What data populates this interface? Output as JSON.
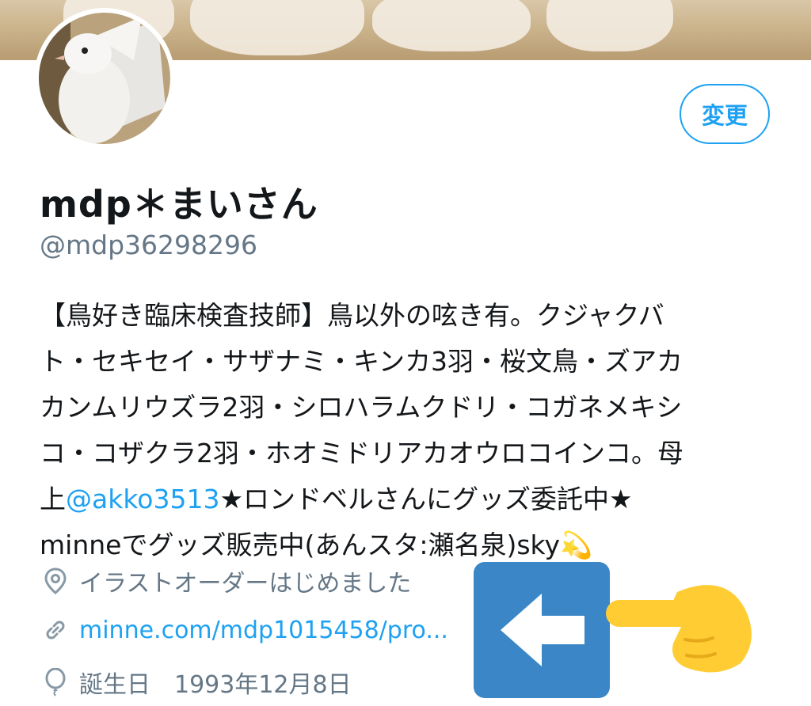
{
  "profile": {
    "edit_button": "変更",
    "display_name": "mdp＊まいさん",
    "handle": "@mdp36298296",
    "bio": {
      "line1": "【鳥好き臨床検査技師】鳥以外の呟き有。クジャクバ",
      "line2": "ト・セキセイ・サザナミ・キンカ3羽・桜文鳥・ズアカ",
      "line3": "カンムリウズラ2羽・シロハラムクドリ・コガネメキシ",
      "line4": "コ・コザクラ2羽・ホオミドリアカオウロコインコ。母",
      "line5_pre": "上",
      "line5_mention": "@akko3513",
      "line5_post": "★ロンドベルさんにグッズ委託中★",
      "line6": "minneでグッズ販売中(あんスタ:瀬名泉)sky",
      "line6_emoji": "💫"
    },
    "location": "イラストオーダーはじめました",
    "website": "minne.com/mdp1015458/pro...",
    "birthday_label": "誕生日",
    "birthday_value": "1993年12月8日"
  },
  "icons": {
    "location": "location-pin-icon",
    "link": "link-icon",
    "birthday": "balloon-icon",
    "overlay_arrow": "left-arrow-icon",
    "overlay_hand": "pointing-hand-icon"
  },
  "colors": {
    "accent": "#1da1f2",
    "secondary_text": "#657786",
    "arrow_box": "#3b86c6",
    "hand": "#ffcc33"
  }
}
